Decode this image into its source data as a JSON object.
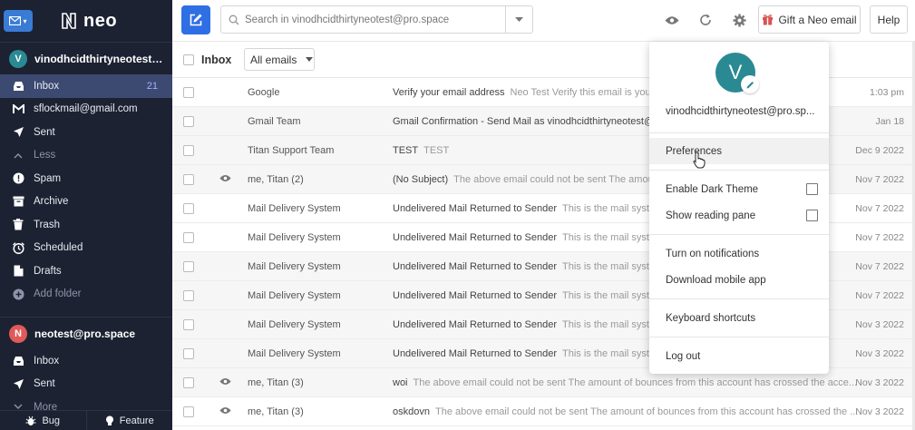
{
  "sidebar": {
    "brand": "neo",
    "account1": {
      "initial": "V",
      "name": "vinodhcidthirtyneotest@p...",
      "color": "#2a8a93"
    },
    "items1": [
      {
        "label": "Inbox",
        "icon": "inbox-icon",
        "count": "21"
      },
      {
        "label": "sflockmail@gmail.com",
        "icon": "gmail-icon"
      },
      {
        "label": "Sent",
        "icon": "send-icon"
      },
      {
        "label": "Less",
        "icon": "chevron-up-icon"
      },
      {
        "label": "Spam",
        "icon": "spam-icon"
      },
      {
        "label": "Archive",
        "icon": "archive-icon"
      },
      {
        "label": "Trash",
        "icon": "trash-icon"
      },
      {
        "label": "Scheduled",
        "icon": "clock-icon"
      },
      {
        "label": "Drafts",
        "icon": "draft-icon"
      },
      {
        "label": "Add folder",
        "icon": "plus-icon"
      }
    ],
    "account2": {
      "initial": "N",
      "name": "neotest@pro.space",
      "color": "#e05a5a"
    },
    "items2": [
      {
        "label": "Inbox",
        "icon": "inbox-icon"
      },
      {
        "label": "Sent",
        "icon": "send-icon"
      },
      {
        "label": "More",
        "icon": "chevron-down-icon"
      }
    ],
    "bottom": {
      "bug": "Bug",
      "feature": "Feature"
    }
  },
  "toolbar": {
    "search_placeholder": "Search in vinodhcidthirtyneotest@pro.space",
    "gift": "Gift a Neo email",
    "help": "Help"
  },
  "list": {
    "title": "Inbox",
    "filter": "All emails",
    "rows": [
      {
        "sender": "Google",
        "subject": "Verify your email address",
        "preview": "Neo Test Verify this email is yours w",
        "date": "1:03 pm",
        "read": false,
        "eye": false
      },
      {
        "sender": "Gmail Team",
        "subject": "Gmail Confirmation - Send Mail as vinodhcidthirtyneotest@pr",
        "preview": "",
        "date": "Jan 18",
        "read": true,
        "eye": false
      },
      {
        "sender": "Titan Support Team",
        "subject": "TEST",
        "preview": "TEST",
        "date": "Dec 9 2022",
        "read": true,
        "eye": false
      },
      {
        "sender": "me, Titan (2)",
        "subject": "(No Subject)",
        "preview": "The above email could not be sent The amount",
        "date": "Nov 7 2022",
        "read": true,
        "eye": true
      },
      {
        "sender": "Mail Delivery System",
        "subject": "Undelivered Mail Returned to Sender",
        "preview": "This is the mail system",
        "date": "Nov 7 2022",
        "read": false,
        "eye": false
      },
      {
        "sender": "Mail Delivery System",
        "subject": "Undelivered Mail Returned to Sender",
        "preview": "This is the mail system",
        "date": "Nov 7 2022",
        "read": false,
        "eye": false
      },
      {
        "sender": "Mail Delivery System",
        "subject": "Undelivered Mail Returned to Sender",
        "preview": "This is the mail system",
        "date": "Nov 7 2022",
        "read": true,
        "eye": false
      },
      {
        "sender": "Mail Delivery System",
        "subject": "Undelivered Mail Returned to Sender",
        "preview": "This is the mail system",
        "date": "Nov 7 2022",
        "read": true,
        "eye": false
      },
      {
        "sender": "Mail Delivery System",
        "subject": "Undelivered Mail Returned to Sender",
        "preview": "This is the mail system",
        "date": "Nov 3 2022",
        "read": true,
        "eye": false
      },
      {
        "sender": "Mail Delivery System",
        "subject": "Undelivered Mail Returned to Sender",
        "preview": "This is the mail system",
        "date": "Nov 3 2022",
        "read": true,
        "eye": false
      },
      {
        "sender": "me, Titan (3)",
        "subject": "woi",
        "preview": "The above email could not be sent The amount of bounces from this account has crossed the acce...",
        "date": "Nov 3 2022",
        "read": true,
        "eye": true
      },
      {
        "sender": "me, Titan (3)",
        "subject": "oskdovn",
        "preview": "The above email could not be sent The amount of bounces from this account has crossed the ...",
        "date": "Nov 3 2022",
        "read": false,
        "eye": true
      }
    ]
  },
  "menu": {
    "avatar_initial": "V",
    "email": "vinodhcidthirtyneotest@pro.sp...",
    "preferences": "Preferences",
    "dark_theme": "Enable Dark Theme",
    "reading_pane": "Show reading pane",
    "notifications": "Turn on notifications",
    "mobile_app": "Download mobile app",
    "shortcuts": "Keyboard shortcuts",
    "logout": "Log out"
  },
  "colors": {
    "sidebar_bg": "#1c2232",
    "active_bg": "#3c4a72",
    "accent": "#2f6fe4",
    "avatar_v": "#2a8a93",
    "avatar_n": "#e05a5a"
  }
}
